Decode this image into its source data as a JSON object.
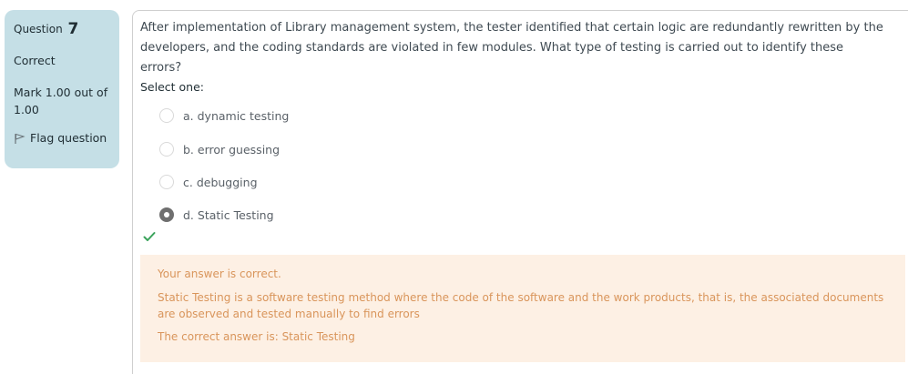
{
  "info": {
    "question_label": "Question",
    "question_number": "7",
    "state": "Correct",
    "grade": "Mark 1.00 out of 1.00",
    "flag_label": "Flag question"
  },
  "question": {
    "text": "After implementation of Library management system, the tester identified that certain logic are redundantly rewritten by the developers, and the coding standards are violated in few modules. What type of testing is carried out to identify these errors?",
    "prompt": "Select one:",
    "options": [
      {
        "label": "a. dynamic testing",
        "selected": false
      },
      {
        "label": "b. error guessing",
        "selected": false
      },
      {
        "label": "c. debugging",
        "selected": false
      },
      {
        "label": "d. Static Testing",
        "selected": true
      }
    ]
  },
  "feedback": {
    "correctness": "Your answer is correct.",
    "general": "Static Testing is a software testing method where the code of the software and the work products, that is, the associated documents are observed and tested manually to find errors",
    "right_answer": "The correct answer is: Static Testing"
  },
  "colors": {
    "info_bg": "#c5dfe6",
    "feedback_bg": "#fdf0e4",
    "feedback_text": "#d9955b",
    "correct_icon": "#3aa35b"
  }
}
